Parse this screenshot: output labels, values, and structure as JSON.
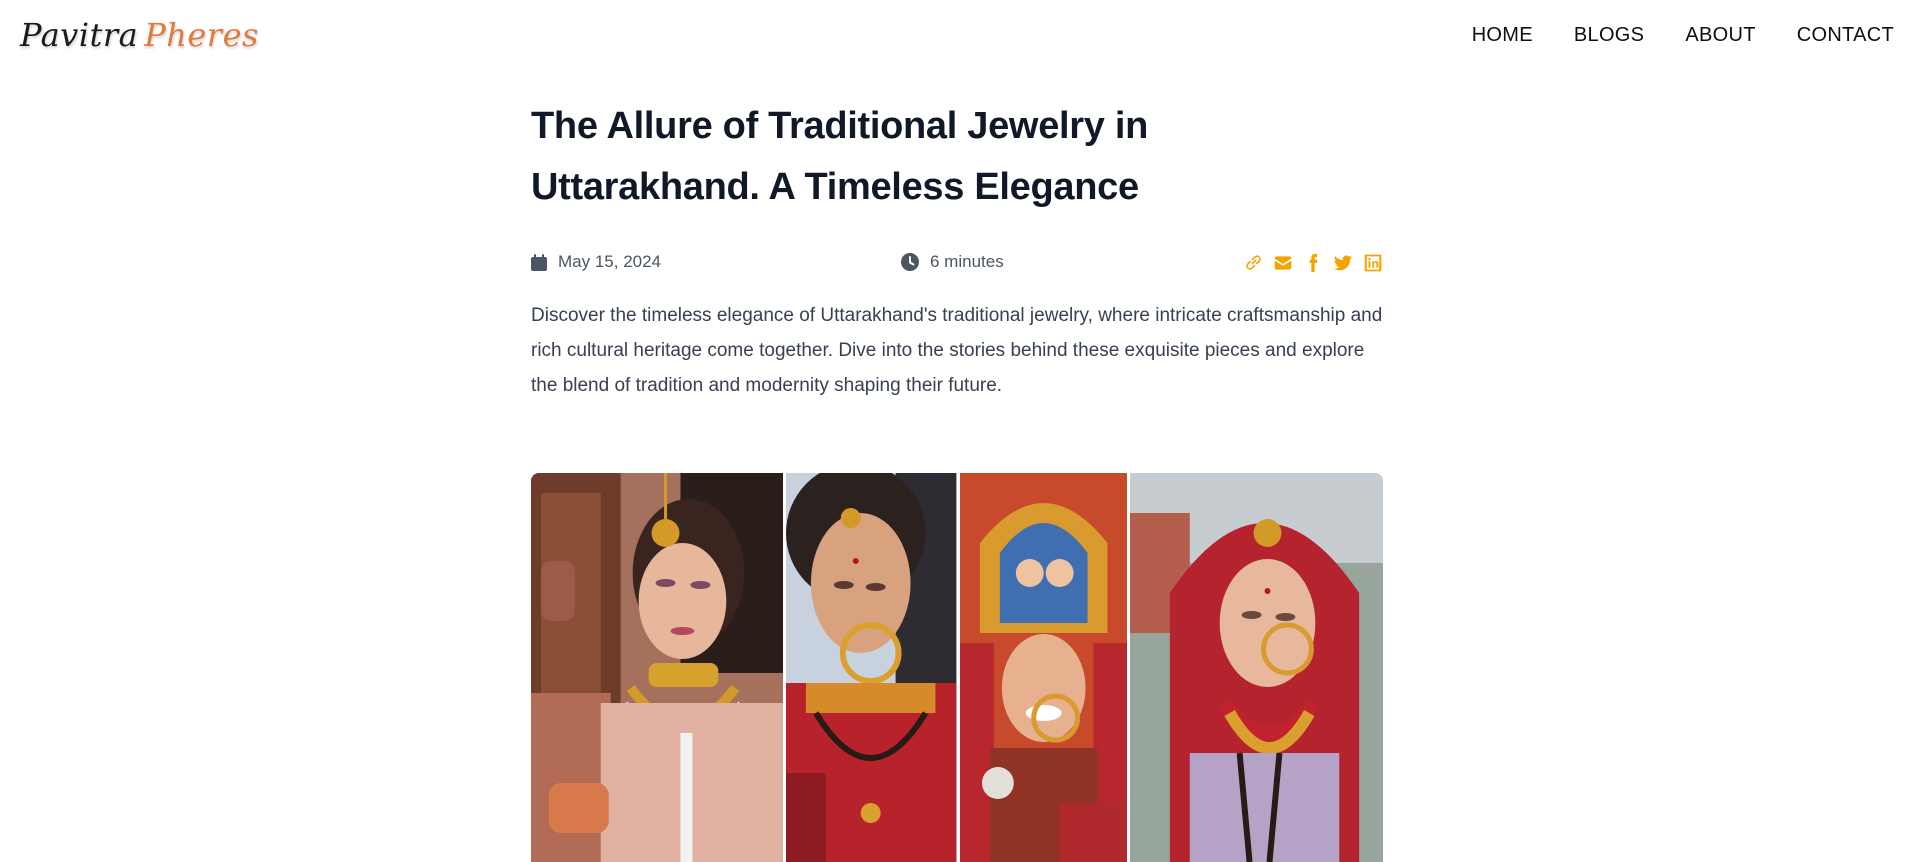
{
  "brand": {
    "first": "Pavitra",
    "second": "Pheres",
    "first_color": "#1f1a17",
    "second_color": "#e07a3f"
  },
  "nav": {
    "items": [
      "HOME",
      "BLOGS",
      "ABOUT",
      "CONTACT"
    ]
  },
  "article": {
    "title": "The Allure of Traditional Jewelry in Uttarakhand. A Timeless Elegance",
    "date": "May 15, 2024",
    "read_time": "6 minutes",
    "summary": "Discover the timeless elegance of Uttarakhand's traditional jewelry, where intricate craftsmanship and rich cultural heritage come together. Dive into the stories behind these exquisite pieces and explore the blend of tradition and modernity shaping their future."
  },
  "share_icons": [
    "link-icon",
    "envelope-icon",
    "facebook-icon",
    "twitter-icon",
    "linkedin-icon"
  ],
  "accent_color": "#f5a300",
  "gallery": {
    "panels": [
      "bride-pink-lehenga",
      "bride-red-nath",
      "bride-crown-smiling",
      "bride-lavender-dupatta"
    ]
  }
}
